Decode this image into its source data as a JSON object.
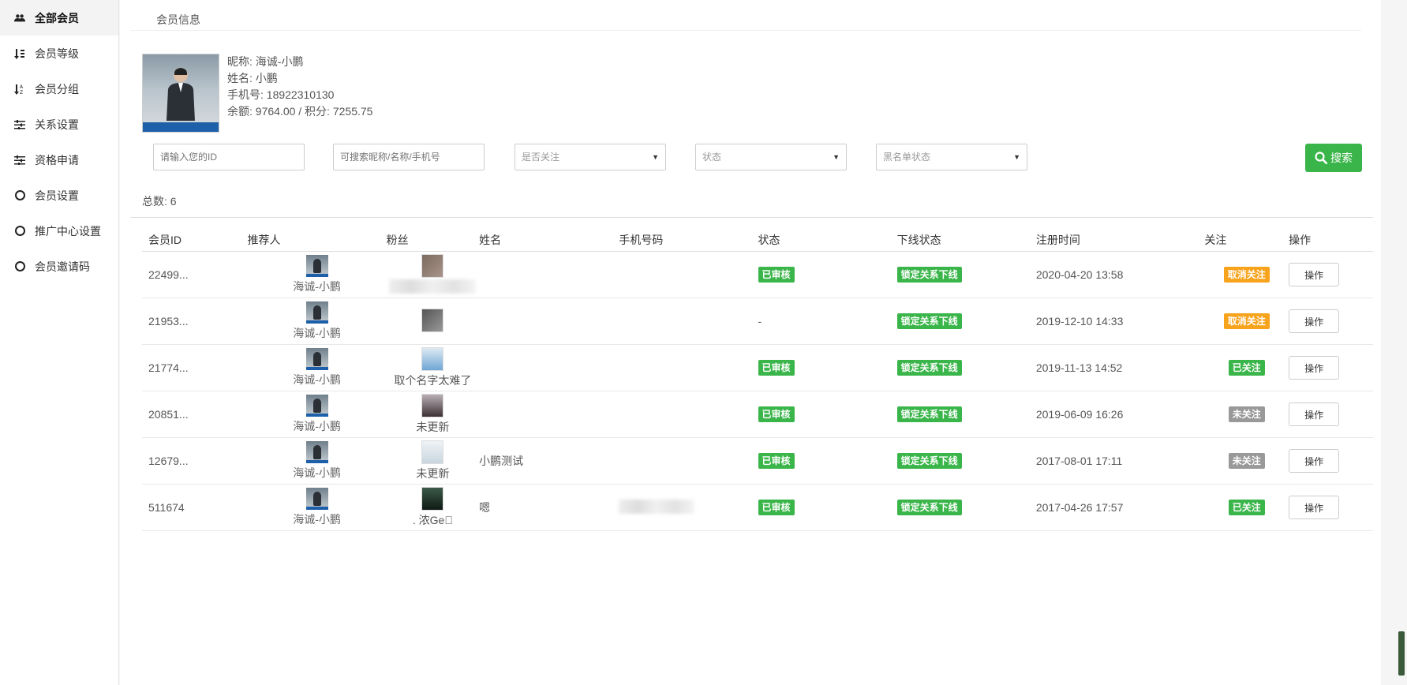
{
  "sidebar": {
    "items": [
      {
        "label": "全部会员",
        "icon": "users-icon"
      },
      {
        "label": "会员等级",
        "icon": "sort-numeric-icon"
      },
      {
        "label": "会员分组",
        "icon": "sort-alpha-icon"
      },
      {
        "label": "关系设置",
        "icon": "sliders-icon"
      },
      {
        "label": "资格申请",
        "icon": "sliders-icon"
      },
      {
        "label": "会员设置",
        "icon": "circle-icon"
      },
      {
        "label": "推广中心设置",
        "icon": "circle-icon"
      },
      {
        "label": "会员邀请码",
        "icon": "circle-icon"
      }
    ]
  },
  "header": {
    "tab": "会员信息"
  },
  "profile": {
    "nickname": "昵称: 海诚-小鹏",
    "name": "姓名: 小鹏",
    "phone": "手机号: 18922310130",
    "balance": "余额: 9764.00 / 积分:  7255.75"
  },
  "filters": {
    "id_placeholder": "请输入您的ID",
    "keyword_placeholder": "可搜索昵称/名称/手机号",
    "follow_select": "是否关注",
    "status_select": "状态",
    "blacklist_select": "黑名单状态",
    "search_label": "搜索"
  },
  "total": "总数:  6",
  "table": {
    "headers": [
      "会员ID",
      "推荐人",
      "粉丝",
      "姓名",
      "手机号码",
      "状态",
      "下线状态",
      "注册时间",
      "关注",
      "操作"
    ],
    "rows": [
      {
        "id": "22499...",
        "ref": "海诚-小鹏",
        "fan": "",
        "name": "",
        "status": "已审核",
        "offline": "锁定关系下线",
        "reg": "2020-04-20 13:58",
        "follow": "取消关注",
        "follow_color": "orange",
        "op": "操作"
      },
      {
        "id": "21953...",
        "ref": "海诚-小鹏",
        "fan": "",
        "name": "",
        "status": "-",
        "offline": "锁定关系下线",
        "reg": "2019-12-10 14:33",
        "follow": "取消关注",
        "follow_color": "orange",
        "op": "操作"
      },
      {
        "id": "21774...",
        "ref": "海诚-小鹏",
        "fan": "取个名字太难了",
        "name": "",
        "status": "已审核",
        "offline": "锁定关系下线",
        "reg": "2019-11-13 14:52",
        "follow": "已关注",
        "follow_color": "green",
        "op": "操作"
      },
      {
        "id": "20851...",
        "ref": "海诚-小鹏",
        "fan": "未更新",
        "name": "",
        "status": "已审核",
        "offline": "锁定关系下线",
        "reg": "2019-06-09 16:26",
        "follow": "未关注",
        "follow_color": "gray",
        "op": "操作"
      },
      {
        "id": "12679...",
        "ref": "海诚-小鹏",
        "fan": "未更新",
        "name": "小鹏测试",
        "status": "已审核",
        "offline": "锁定关系下线",
        "reg": "2017-08-01 17:11",
        "follow": "未关注",
        "follow_color": "gray",
        "op": "操作"
      },
      {
        "id": "511674",
        "ref": "海诚-小鹏",
        "fan": ". 浓Ge\u0000",
        "name": "嗯",
        "status": "已审核",
        "offline": "锁定关系下线",
        "reg": "2017-04-26 17:57",
        "follow": "已关注",
        "follow_color": "green",
        "op": "操作"
      }
    ]
  },
  "colors": {
    "green": "#3ab54a",
    "orange": "#f7a31c",
    "gray": "#999999"
  }
}
